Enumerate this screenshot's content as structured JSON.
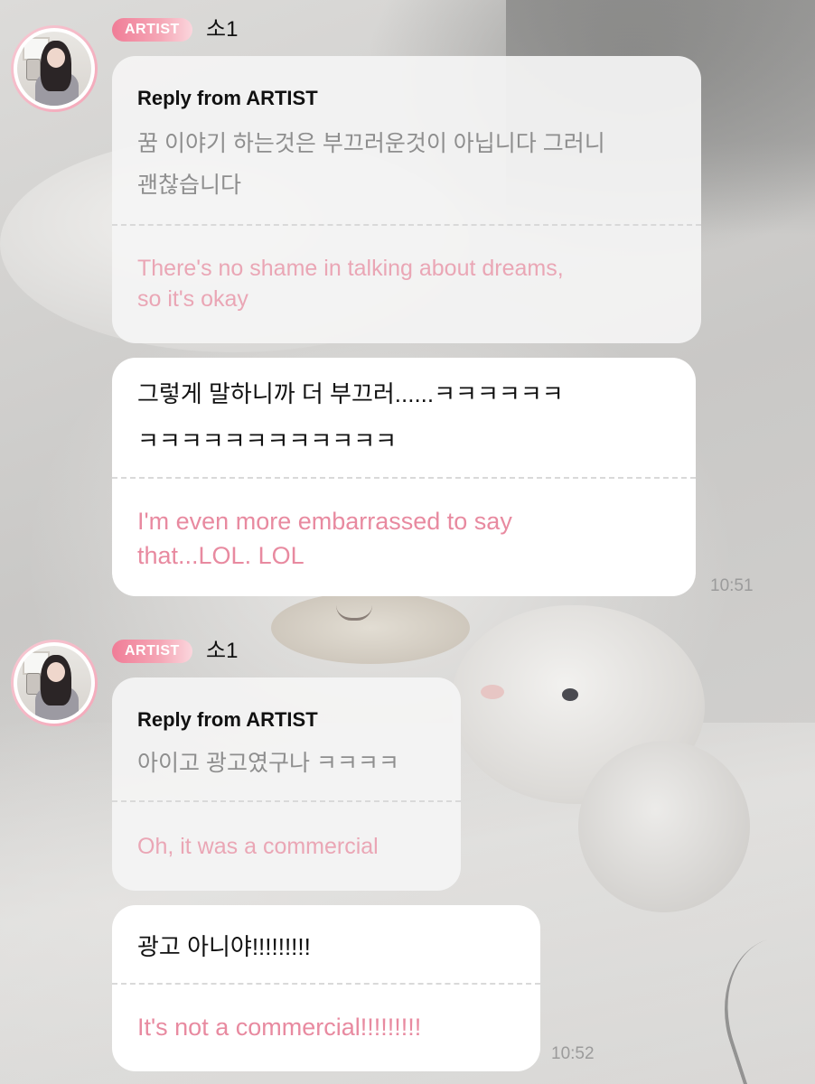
{
  "chat": {
    "groups": [
      {
        "sender": {
          "badge": "ARTIST",
          "name": "소1"
        },
        "reply": {
          "heading": "Reply from ARTIST",
          "original_lines": [
            "꿈 이야기 하는것은 부끄러운것이 아닙니다 그러니",
            "괜찮습니다"
          ],
          "translation_lines": [
            "There's no shame in talking about dreams,",
            "so it's okay"
          ]
        },
        "message": {
          "lines": [
            "그렇게 말하니까 더 부끄러......ㅋㅋㅋㅋㅋㅋ",
            "ㅋㅋㅋㅋㅋㅋㅋㅋㅋㅋㅋㅋ"
          ],
          "translation_lines": [
            "I'm even more embarrassed to say",
            "that...LOL. LOL"
          ],
          "time": "10:51"
        }
      },
      {
        "sender": {
          "badge": "ARTIST",
          "name": "소1"
        },
        "reply": {
          "heading": "Reply from ARTIST",
          "original_lines": [
            "아이고 광고였구나 ㅋㅋㅋㅋ"
          ],
          "translation_lines": [
            "Oh, it was a commercial"
          ]
        },
        "message": {
          "lines": [
            "광고 아니야!!!!!!!!!"
          ],
          "translation_lines": [
            "It's not a commercial!!!!!!!!!"
          ],
          "time": "10:52"
        }
      }
    ]
  }
}
